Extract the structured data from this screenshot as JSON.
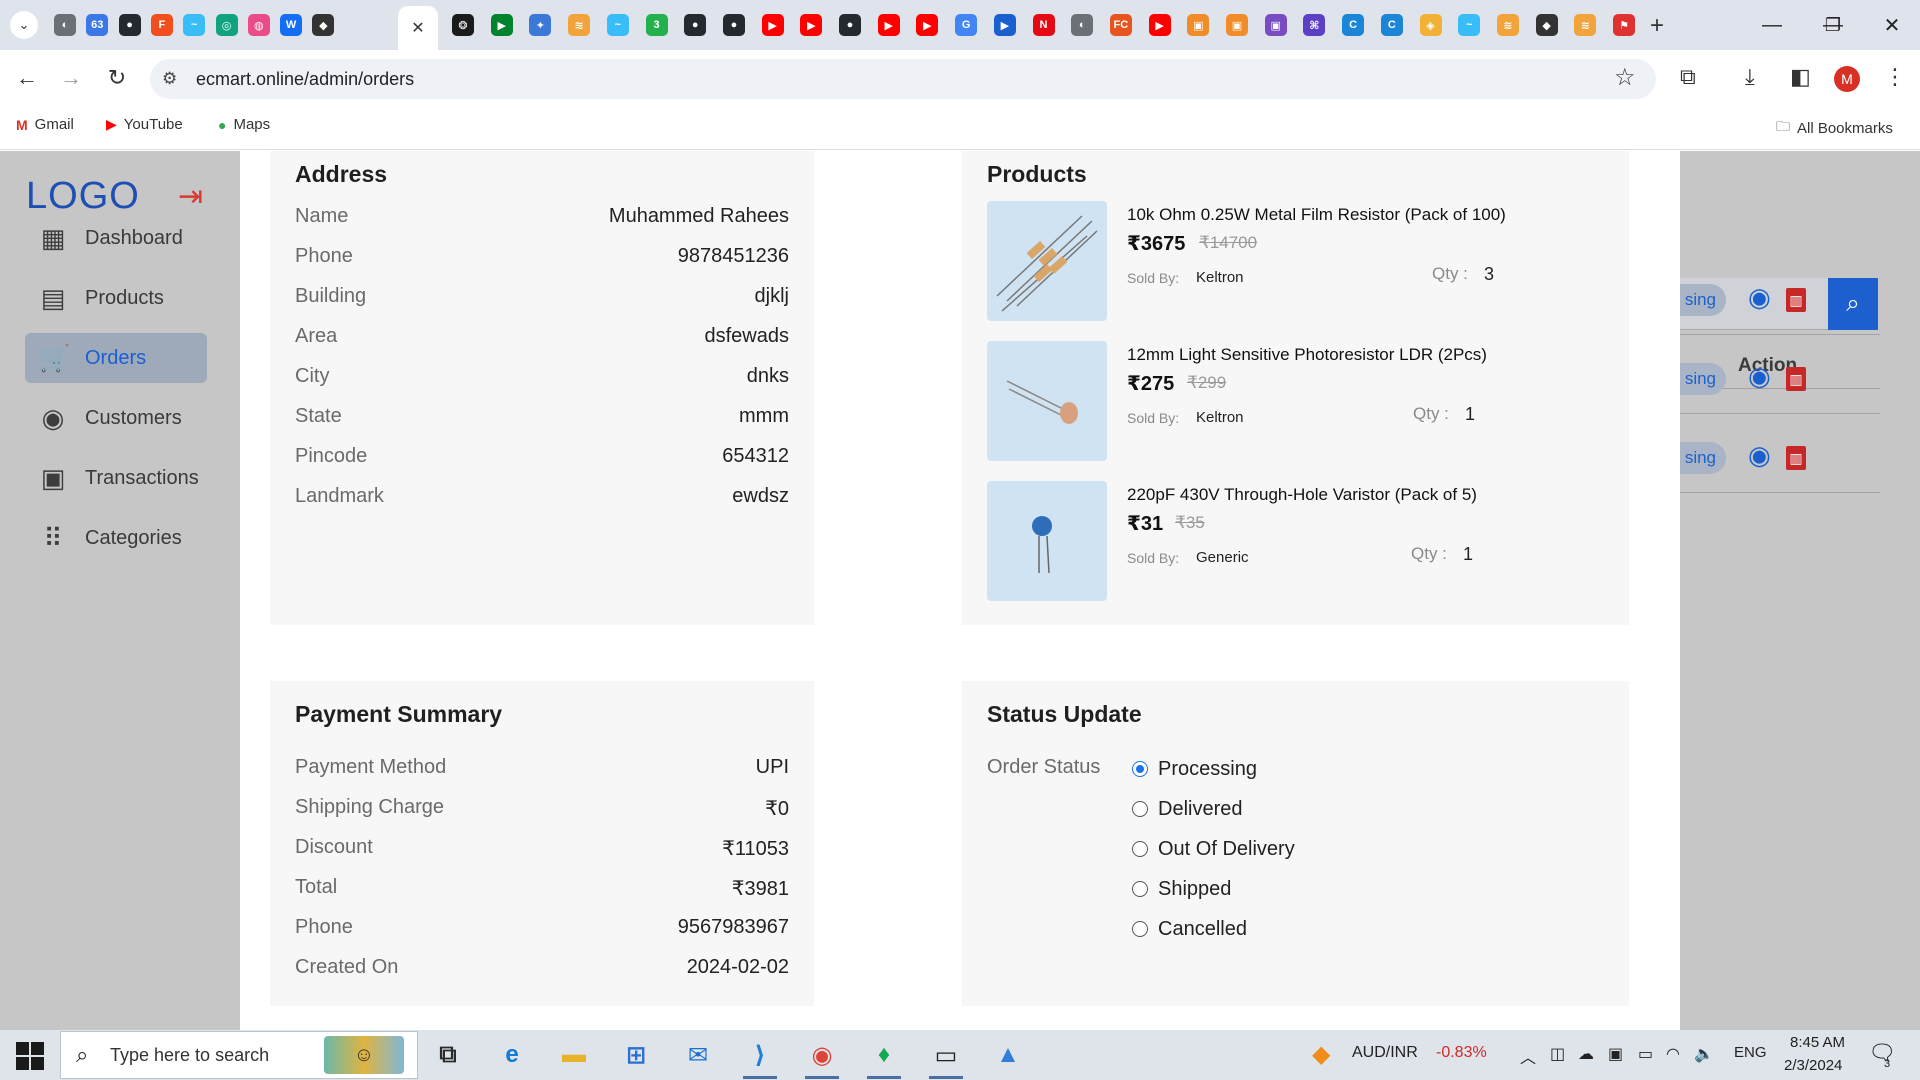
{
  "browser": {
    "tab_dropdown_icon": "chevron-down-icon",
    "active_tab_close": "✕",
    "tab_favicons": [
      {
        "icon": "globe-icon",
        "color": "#6b6f76",
        "glyph": "◐"
      },
      {
        "icon": "badge-icon",
        "color": "#3b78e7",
        "glyph": "63"
      },
      {
        "icon": "github-icon",
        "color": "#24292f",
        "glyph": "●"
      },
      {
        "icon": "figma-icon",
        "color": "#f24e1e",
        "glyph": "F"
      },
      {
        "icon": "tailwind-icon",
        "color": "#38bdf8",
        "glyph": "~"
      },
      {
        "icon": "openai-icon",
        "color": "#10a37f",
        "glyph": "◎"
      },
      {
        "icon": "dribbble-icon",
        "color": "#ea4c89",
        "glyph": "◍"
      },
      {
        "icon": "webflow-icon",
        "color": "#146ef5",
        "glyph": "W"
      },
      {
        "icon": "graduation-icon",
        "color": "#333333",
        "glyph": "◆"
      }
    ],
    "tab_favicons_right": [
      {
        "icon": "chatgpt-icon",
        "color": "#1b1b1b",
        "glyph": "❂"
      },
      {
        "icon": "meet-icon",
        "color": "#00832d",
        "glyph": "▶"
      },
      {
        "icon": "puzzle-icon",
        "color": "#3c78d8",
        "glyph": "✦"
      },
      {
        "icon": "swirl-icon",
        "color": "#f2a33a",
        "glyph": "≋"
      },
      {
        "icon": "tailwind-icon",
        "color": "#38bdf8",
        "glyph": "~"
      },
      {
        "icon": "number-icon",
        "color": "#22b14c",
        "glyph": "3"
      },
      {
        "icon": "github-icon",
        "color": "#24292f",
        "glyph": "●"
      },
      {
        "icon": "github-icon",
        "color": "#24292f",
        "glyph": "●"
      },
      {
        "icon": "youtube-icon",
        "color": "#ff0000",
        "glyph": "▶"
      },
      {
        "icon": "youtube-icon",
        "color": "#ff0000",
        "glyph": "▶"
      },
      {
        "icon": "github-icon",
        "color": "#24292f",
        "glyph": "●"
      },
      {
        "icon": "youtube-icon",
        "color": "#ff0000",
        "glyph": "▶"
      },
      {
        "icon": "youtube-icon",
        "color": "#ff0000",
        "glyph": "▶"
      },
      {
        "icon": "google-icon",
        "color": "#4285f4",
        "glyph": "G"
      },
      {
        "icon": "play-icon",
        "color": "#1a5fd0",
        "glyph": "▶"
      },
      {
        "icon": "netflix-icon",
        "color": "#e50914",
        "glyph": "N"
      },
      {
        "icon": "globe-icon",
        "color": "#6b6f76",
        "glyph": "◐"
      },
      {
        "icon": "fc-icon",
        "color": "#e8541e",
        "glyph": "FC"
      },
      {
        "icon": "youtube-icon",
        "color": "#ff0000",
        "glyph": "▶"
      },
      {
        "icon": "box-icon",
        "color": "#f28c28",
        "glyph": "▣"
      },
      {
        "icon": "box-icon",
        "color": "#f28c28",
        "glyph": "▣"
      },
      {
        "icon": "box-icon",
        "color": "#7a4cc2",
        "glyph": "▣"
      },
      {
        "icon": "grid-icon",
        "color": "#5b3fc4",
        "glyph": "⌘"
      },
      {
        "icon": "edge-icon",
        "color": "#1b86d8",
        "glyph": "C"
      },
      {
        "icon": "edge-icon",
        "color": "#1b86d8",
        "glyph": "C"
      },
      {
        "icon": "cube-icon",
        "color": "#f2b134",
        "glyph": "◈"
      },
      {
        "icon": "tailwind-icon",
        "color": "#38bdf8",
        "glyph": "~"
      },
      {
        "icon": "swirl-icon",
        "color": "#f2a33a",
        "glyph": "≋"
      },
      {
        "icon": "graduation-icon",
        "color": "#333333",
        "glyph": "◆"
      },
      {
        "icon": "swirl-icon",
        "color": "#f2a33a",
        "glyph": "≋"
      },
      {
        "icon": "flag-icon",
        "color": "#e03131",
        "glyph": "⚑"
      }
    ],
    "url": "ecmart.online/admin/orders",
    "profile_initial": "M",
    "bookmarks": [
      {
        "label": "Gmail",
        "icon": "gmail-icon",
        "glyph": "M",
        "color": "#d93025"
      },
      {
        "label": "YouTube",
        "icon": "youtube-icon",
        "glyph": "▶",
        "color": "#ff0000"
      },
      {
        "label": "Maps",
        "icon": "maps-icon",
        "glyph": "●",
        "color": "#34a853"
      }
    ],
    "all_bookmarks": "All Bookmarks"
  },
  "sidebar": {
    "logo": "LOGO",
    "items": [
      {
        "label": "Dashboard",
        "icon": "dashboard-icon",
        "glyph": "▦",
        "active": false
      },
      {
        "label": "Products",
        "icon": "archive-icon",
        "glyph": "▤",
        "active": false
      },
      {
        "label": "Orders",
        "icon": "cart-icon",
        "glyph": "🛒",
        "active": true
      },
      {
        "label": "Customers",
        "icon": "user-circle-icon",
        "glyph": "◉",
        "active": false
      },
      {
        "label": "Transactions",
        "icon": "cash-icon",
        "glyph": "▣",
        "active": false
      },
      {
        "label": "Categories",
        "icon": "apps-icon",
        "glyph": "⠿",
        "active": false
      }
    ]
  },
  "background_table": {
    "action_header": "Action",
    "status_partial": "sing",
    "rows": 3
  },
  "address": {
    "title": "Address",
    "fields": [
      {
        "label": "Name",
        "value": "Muhammed Rahees"
      },
      {
        "label": "Phone",
        "value": "9878451236"
      },
      {
        "label": "Building",
        "value": "djklj"
      },
      {
        "label": "Area",
        "value": "dsfewads"
      },
      {
        "label": "City",
        "value": "dnks"
      },
      {
        "label": "State",
        "value": "mmm"
      },
      {
        "label": "Pincode",
        "value": "654312"
      },
      {
        "label": "Landmark",
        "value": "ewdsz"
      }
    ]
  },
  "products": {
    "title": "Products",
    "sold_by_label": "Sold By:",
    "qty_label": "Qty :",
    "items": [
      {
        "name": "10k Ohm 0.25W Metal Film Resistor (Pack of 100)",
        "price": "₹3675",
        "mrp": "₹14700",
        "seller": "Keltron",
        "qty": "3",
        "image": "resistor-image"
      },
      {
        "name": "12mm Light Sensitive Photoresistor LDR (2Pcs)",
        "price": "₹275",
        "mrp": "₹299",
        "seller": "Keltron",
        "qty": "1",
        "image": "ldr-image"
      },
      {
        "name": "220pF 430V Through-Hole Varistor (Pack of 5)",
        "price": "₹31",
        "mrp": "₹35",
        "seller": "Generic",
        "qty": "1",
        "image": "varistor-image"
      }
    ]
  },
  "payment": {
    "title": "Payment Summary",
    "fields": [
      {
        "label": "Payment Method",
        "value": "UPI"
      },
      {
        "label": "Shipping Charge",
        "value": "₹0"
      },
      {
        "label": "Discount",
        "value": "₹11053"
      },
      {
        "label": "Total",
        "value": "₹3981"
      },
      {
        "label": "Phone",
        "value": "9567983967"
      },
      {
        "label": "Created On",
        "value": "2024-02-02"
      }
    ]
  },
  "status": {
    "title": "Status Update",
    "label": "Order Status",
    "options": [
      "Processing",
      "Delivered",
      "Out Of Delivery",
      "Shipped",
      "Cancelled"
    ],
    "selected": "Processing"
  },
  "taskbar": {
    "search_placeholder": "Type here to search",
    "apps": [
      {
        "name": "task-view-icon",
        "glyph": "⧉",
        "color": "#2b2b2b"
      },
      {
        "name": "edge-app-icon",
        "glyph": "e",
        "color": "#0f7bd8"
      },
      {
        "name": "file-explorer-icon",
        "glyph": "▬",
        "color": "#e8b22a"
      },
      {
        "name": "store-icon",
        "glyph": "⊞",
        "color": "#2a6fd1"
      },
      {
        "name": "mail-icon",
        "glyph": "✉",
        "color": "#1a6fd1"
      },
      {
        "name": "vscode-icon",
        "glyph": "⟩",
        "color": "#1f7fd6"
      },
      {
        "name": "chrome-icon",
        "glyph": "◉",
        "color": "#db4437"
      },
      {
        "name": "mongodb-icon",
        "glyph": "♦",
        "color": "#13aa52"
      },
      {
        "name": "terminal-icon",
        "glyph": "▭",
        "color": "#1e1e1e"
      },
      {
        "name": "photos-icon",
        "glyph": "▲",
        "color": "#2f7fd8"
      }
    ],
    "ticker_label": "AUD/INR",
    "ticker_value": "-0.83%",
    "language": "ENG",
    "time": "8:45 AM",
    "date": "2/3/2024",
    "notifications": "3"
  }
}
